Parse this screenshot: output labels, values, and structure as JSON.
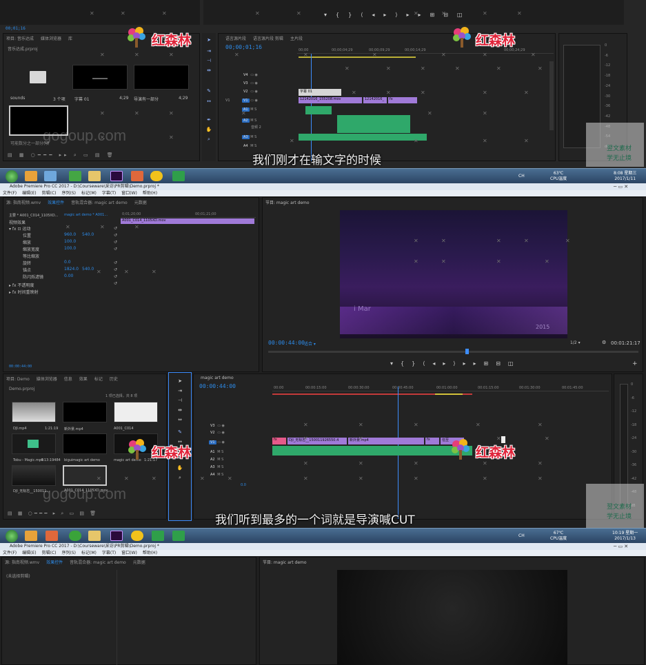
{
  "frame1": {
    "timecode_small": "00;01;16",
    "project_tabs": [
      "项目: 音乐达成",
      "媒体浏览器",
      "库"
    ],
    "project_file": "音乐达成.prproj",
    "selection_count": "1 项已选择，共 18 项",
    "items": [
      {
        "name": "sounds",
        "meta": "3 个项"
      },
      {
        "name": "字幕 01",
        "meta": "4;29"
      },
      {
        "name": "导演有一部分",
        "meta": "4;29"
      },
      {
        "name": "可能数分之一部分(项",
        "meta": ""
      }
    ],
    "seq_tabs": [
      "语言源片段",
      "语言源片段 剪辑",
      "主片段"
    ],
    "seq_timecode": "00;00;01;16",
    "ruler": [
      "00;00",
      "00;00;04;29",
      "00;00;09;29",
      "00;00;14;29",
      "00;00;24;29"
    ],
    "tracks_video": [
      "V4",
      "V3",
      "V2",
      "V1"
    ],
    "tracks_audio": [
      "A1",
      "A2",
      "A3",
      "A4"
    ],
    "track_labels": [
      "M",
      "S"
    ],
    "audio_track_name": "音频 2",
    "v1_label": "V1",
    "clips": [
      "字幕 01",
      "12142016_155208.mov",
      "12142016_",
      "fx"
    ],
    "meter_db": [
      "0",
      "-6",
      "-12",
      "-18",
      "-24",
      "-30",
      "-36",
      "-42",
      "-48",
      "-54",
      "dB"
    ],
    "subtitle": "我们刚才在输文字的时候"
  },
  "taskbar1": {
    "clock_time": "8:08 星期三",
    "clock_date": "2017/1/11",
    "temp": "63℃",
    "temp_label": "CPU温度",
    "lang": "CH"
  },
  "frame2": {
    "window_title": "Adobe Premiere Pro CC 2017 - D:\\Courseware\\采访\\PR剪辑\\Demo.prproj *",
    "menu": [
      "文件(F)",
      "编辑(E)",
      "剪辑(C)",
      "序列(S)",
      "标记(M)",
      "字幕(T)",
      "窗口(W)",
      "帮助(H)"
    ],
    "source_tabs": [
      "源: 指南视频.wmv",
      "效果控件",
      "音轨混合器: magic art demo",
      "元数据"
    ],
    "master_label": "主要 * A001_C014_1105XD...",
    "seq_label": "magic art demo * A001...",
    "mini_ruler": [
      "0;01;20;00",
      "00;01;21;00"
    ],
    "clip_label": "A001_C014_1105XD.mov",
    "fx_header": "视频效果",
    "fx_groups": [
      "运动",
      "不透明度",
      "时间重映射"
    ],
    "fx_params": [
      {
        "name": "位置",
        "v1": "960.0",
        "v2": "540.0"
      },
      {
        "name": "缩放",
        "v1": "100.0",
        "v2": ""
      },
      {
        "name": "缩放宽度",
        "v1": "100.0",
        "v2": ""
      },
      {
        "name": "等比缩放",
        "v1": "",
        "v2": ""
      },
      {
        "name": "旋转",
        "v1": "0.0",
        "v2": ""
      },
      {
        "name": "锚点",
        "v1": "1824.0",
        "v2": "540.0"
      },
      {
        "name": "防闪烁滤镜",
        "v1": "0.00",
        "v2": ""
      }
    ],
    "fx_time": "00:00:44:00",
    "program_title": "节目: magic art demo",
    "program_tc": "00:00:44:00",
    "fit_label": "适合",
    "ratio": "1/2",
    "program_dur": "00:01:21:17",
    "video_text_1": "i Mar",
    "video_text_2": "2015",
    "project_tabs": [
      "项目: Demo",
      "媒体浏览器",
      "信息",
      "效果",
      "标记",
      "历史"
    ],
    "project_file": "Demo.prproj",
    "selection_count": "1 项已选择，共 8 项",
    "bins": [
      {
        "name": "DJI.mp4",
        "dur": "1:21:19"
      },
      {
        "name": "新外景.mp4",
        "dur": ""
      },
      {
        "name": "A001_C014",
        "dur": ""
      },
      {
        "name": "Tobu - Magic.mp3",
        "dur": "4:13:19484"
      },
      {
        "name": "biguimagic art demo",
        "dur": ""
      },
      {
        "name": "magic art demo",
        "dur": "1:21:17"
      },
      {
        "name": "DJI_无标志__150011...",
        "dur": ""
      },
      {
        "name": "A001_C014_1105XD.mov",
        "dur": ""
      }
    ],
    "seq_title": "magic art demo",
    "seq_tc": "00:00:44:00",
    "seq_ruler": [
      "00:00",
      "00:00:15:00",
      "00:00:30:00",
      "00:00:45:00",
      "00:01:00:00",
      "00:01:15:00",
      "00:01:30:00",
      "00:01:45:00"
    ],
    "tracks": [
      "V3",
      "V2",
      "V1",
      "A1",
      "A2",
      "A3",
      "A4"
    ],
    "track_vol": "0.0",
    "clips": [
      "fx",
      "DJI_无标志__150011926550.4",
      "新外景.mp4",
      "fx",
      "信至"
    ],
    "meter_db": [
      "0",
      "-6",
      "-12",
      "-18",
      "-24",
      "-30",
      "-36",
      "-42",
      "-48",
      "dB"
    ],
    "subtitle": "我们听到最多的一个词就是导演喊CUT"
  },
  "taskbar2": {
    "clock_time": "10:19 星期一",
    "clock_date": "2017/1/13",
    "temp": "67℃",
    "temp_label": "CPU温度",
    "lang": "CH"
  },
  "frame3": {
    "window_title": "Adobe Premiere Pro CC 2017 - D:\\Courseware\\采访\\PR剪辑\\Demo.prproj *",
    "menu": [
      "文件(F)",
      "编辑(E)",
      "剪辑(C)",
      "序列(S)",
      "标记(M)",
      "字幕(T)",
      "窗口(W)",
      "帮助(H)"
    ],
    "source_tabs": [
      "源: 指南视频.wmv",
      "效果控件",
      "音轨混合器: magic art demo",
      "元数据"
    ],
    "empty_label": "(未选择剪辑)",
    "program_title": "节目: magic art demo"
  },
  "watermarks": {
    "brand": "红森林",
    "site": "gogoup.com",
    "corner_top": "翌文素材",
    "corner_bottom": "学无止境"
  },
  "colors": {
    "accent": "#2d8ceb",
    "playhead": "#3d8dff",
    "video_clip": "#a07ad8",
    "audio_clip": "#2fa86a",
    "title_clip": "#e65a8a"
  }
}
